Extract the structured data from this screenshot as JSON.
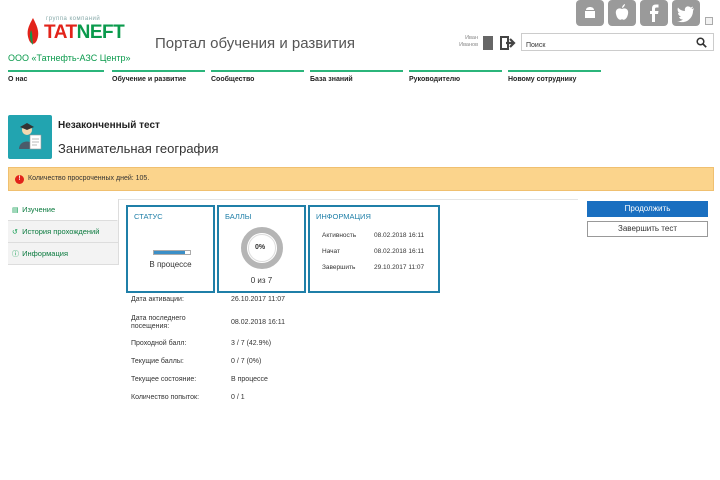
{
  "header": {
    "logo_group_text": "группа компаний",
    "logo_word_a": "TAT",
    "logo_word_b": "NEFT",
    "company": "ООО «Татнефть-АЗС Центр»",
    "portal_title": "Портал обучения и развития",
    "user_first": "Иван",
    "user_last": "Иванов",
    "search_value": "Поиск",
    "social_icons": [
      "android-icon",
      "apple-icon",
      "facebook-icon",
      "twitter-icon"
    ]
  },
  "nav": {
    "items": [
      {
        "label": "О нас"
      },
      {
        "label": "Обучение и развитие"
      },
      {
        "label": "Сообщество"
      },
      {
        "label": "База знаний"
      },
      {
        "label": "Руководителю"
      },
      {
        "label": "Новому сотруднику"
      }
    ]
  },
  "page": {
    "label": "Незаконченный тест",
    "title": "Занимательная география",
    "alert": "Количество просроченных дней: 105."
  },
  "sidebar": {
    "items": [
      {
        "label": "Изучение",
        "icon": "book-icon",
        "active": true
      },
      {
        "label": "История прохождений",
        "icon": "history-icon",
        "active": false
      },
      {
        "label": "Информация",
        "icon": "info-icon",
        "active": false
      }
    ]
  },
  "status_card": {
    "title": "СТАТУС",
    "state": "В процессе",
    "progress": 0.85
  },
  "score_card": {
    "title": "БАЛЛЫ",
    "percent": "0%",
    "score": "0 из 7"
  },
  "info_card": {
    "title": "ИНФОРМАЦИЯ",
    "rows": [
      {
        "key": "Активность",
        "value": "08.02.2018 16:11"
      },
      {
        "key": "Начат",
        "value": "08.02.2018 16:11"
      },
      {
        "key": "Завершить",
        "value": "29.10.2017 11:07"
      }
    ]
  },
  "details": [
    {
      "key": "Дата активации:",
      "value": "26.10.2017 11:07"
    },
    {
      "key": "Дата последнего посещения:",
      "value": "08.02.2018 16:11"
    },
    {
      "key": "Проходной балл:",
      "value": "3 / 7 (42.9%)"
    },
    {
      "key": "Текущие баллы:",
      "value": "0 / 7 (0%)"
    },
    {
      "key": "Текущее состояние:",
      "value": "В процессе"
    },
    {
      "key": "Количество попыток:",
      "value": "0 / 1"
    }
  ],
  "actions": {
    "continue_label": "Продолжить",
    "finish_label": "Завершить тест"
  },
  "colors": {
    "brand_green": "#0a9a4c",
    "brand_red": "#e2231a",
    "accent_blue": "#1f7fa8",
    "button_blue": "#1a6fc0",
    "alert_bg": "#fbd48c"
  }
}
